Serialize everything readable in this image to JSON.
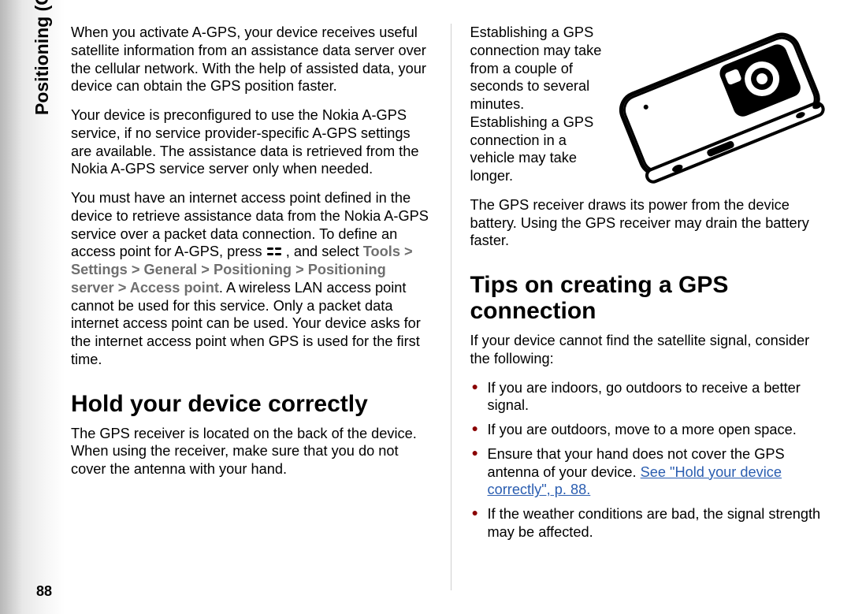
{
  "meta": {
    "section_label": "Positioning (GPS)",
    "page_number": "88"
  },
  "col1": {
    "para1": "When you activate A-GPS, your device receives useful satellite information from an assistance data server over the cellular network. With the help of assisted data, your device can obtain the GPS position faster.",
    "para2": "Your device is preconfigured to use the Nokia A-GPS service, if no service provider-specific A-GPS settings are available. The assistance data is retrieved from the Nokia A-GPS service server only when needed.",
    "para3a": "You must have an internet access point defined in the device to retrieve assistance data from the Nokia A-GPS service over a packet data connection. To define an access point for A-GPS, press ",
    "para3b": " , and select ",
    "menu": {
      "m1": "Tools",
      "m2": "Settings",
      "m3": "General",
      "m4": "Positioning",
      "m5": "Positioning server",
      "m6": "Access point"
    },
    "para3c": ". A wireless LAN access point cannot be used for this service. Only a packet data internet access point can be used. Your device asks for the internet access point when GPS is used for the first time.",
    "heading1": "Hold your device correctly",
    "para4": "The GPS receiver is located on the back of the device. When using the receiver, make sure that you do not cover the antenna with your hand."
  },
  "col2": {
    "para1": "Establishing a GPS connection may take from a couple of seconds to several minutes. Establishing a GPS connection in a vehicle may take longer.",
    "para2": "The GPS receiver draws its power from the device battery. Using the GPS receiver may drain the battery faster.",
    "heading1": "Tips on creating a GPS connection",
    "intro": "If your device cannot find the satellite signal, consider the following:",
    "tips": {
      "t1": "If you are indoors, go outdoors to receive a better signal.",
      "t2": "If you are outdoors, move to a more open space.",
      "t3a": "Ensure that your hand does not cover the GPS antenna of your device. ",
      "t3link": "See \"Hold your device correctly\", p. 88.",
      "t4": "If the weather conditions are bad, the signal strength may be affected."
    }
  }
}
